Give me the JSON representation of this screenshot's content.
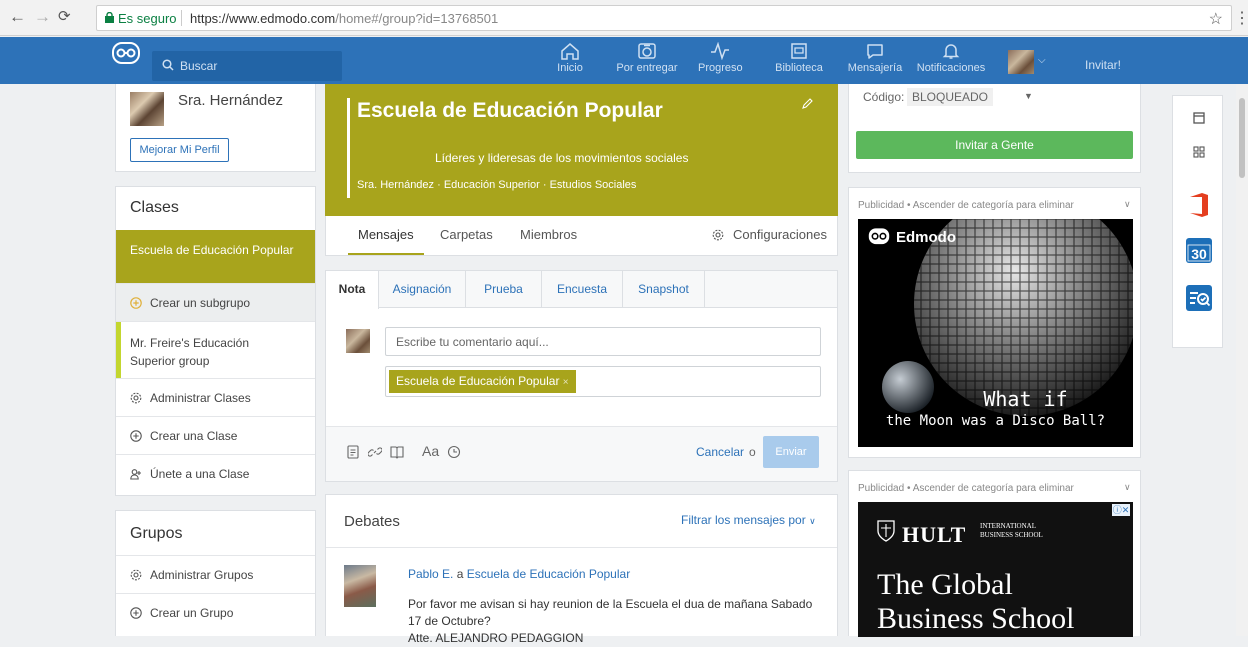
{
  "browser": {
    "secure_label": "Es seguro",
    "url_base": "https://www.edmodo.com",
    "url_path": "/home#/group?id=13768501"
  },
  "topnav": {
    "search_placeholder": "Buscar",
    "items": [
      {
        "label": "Inicio",
        "icon": "home-icon"
      },
      {
        "label": "Por entregar",
        "icon": "camera-icon"
      },
      {
        "label": "Progreso",
        "icon": "pulse-icon"
      },
      {
        "label": "Biblioteca",
        "icon": "library-icon"
      },
      {
        "label": "Mensajería",
        "icon": "chat-icon"
      },
      {
        "label": "Notificaciones",
        "icon": "bell-icon"
      }
    ],
    "invite_label": "Invitar!"
  },
  "profile": {
    "name": "Sra. Hernández",
    "upgrade_label": "Mejorar Mi Perfil"
  },
  "classes": {
    "title": "Clases",
    "active_class": "Escuela de Educación Popular",
    "rows": [
      {
        "label": "Crear un subgrupo",
        "icon": "plus-circle-icon"
      },
      {
        "label": "Mr. Freire's Educación Superior group",
        "icon": ""
      },
      {
        "label": "Administrar Clases",
        "icon": "gear-icon"
      },
      {
        "label": "Crear una Clase",
        "icon": "plus-circle-icon"
      },
      {
        "label": "Únete a una Clase",
        "icon": "join-icon"
      }
    ]
  },
  "groups": {
    "title": "Grupos",
    "rows": [
      {
        "label": "Administrar Grupos",
        "icon": "gear-icon"
      },
      {
        "label": "Crear un Grupo",
        "icon": "plus-circle-icon"
      }
    ]
  },
  "banner": {
    "title": "Escuela de Educación Popular",
    "subtitle": "Líderes y lideresas de los movimientos sociales",
    "meta": "Sra. Hernández · Educación Superior · Estudios Sociales",
    "color": "#a8a41c"
  },
  "tabs": {
    "mensajes": "Mensajes",
    "carpetas": "Carpetas",
    "miembros": "Miembros",
    "config": "Configuraciones"
  },
  "composer": {
    "tabs": [
      "Nota",
      "Asignación",
      "Prueba",
      "Encuesta",
      "Snapshot"
    ],
    "comment_placeholder": "Escribe tu comentario aquí...",
    "recipient": "Escuela de Educación Popular",
    "chip_close": "×",
    "font_label": "Aa",
    "cancel": "Cancelar",
    "or": "o",
    "send": "Enviar"
  },
  "debates": {
    "title": "Debates",
    "filter": "Filtrar los mensajes por",
    "post": {
      "author": "Pablo E.",
      "a": "a",
      "group": "Escuela de Educación Popular",
      "line1": "Por favor me avisan si hay reunion de la Escuela el dua de mañana Sabado",
      "line2": "17 de Octubre?",
      "line3": "Atte. ALEJANDRO PEDAGGION"
    }
  },
  "code": {
    "label": "Código:",
    "value": "BLOQUEADO",
    "invite": "Invitar a Gente"
  },
  "ads": {
    "header": "Publicidad",
    "dot": "•",
    "upgrade": "Ascender de categoría para eliminar",
    "ad1": {
      "brand": "Edmodo",
      "line1": "What if",
      "line2": "the Moon was a Disco Ball?"
    },
    "ad2": {
      "brand": "HULT",
      "brand_sub1": "INTERNATIONAL",
      "brand_sub2": "BUSINESS SCHOOL",
      "line1": "The Global",
      "line2": "Business School",
      "badge": "ⓘ✕"
    }
  },
  "colors": {
    "brand_blue": "#2d72b8",
    "olive": "#a8a41c",
    "green": "#5cb85c"
  }
}
